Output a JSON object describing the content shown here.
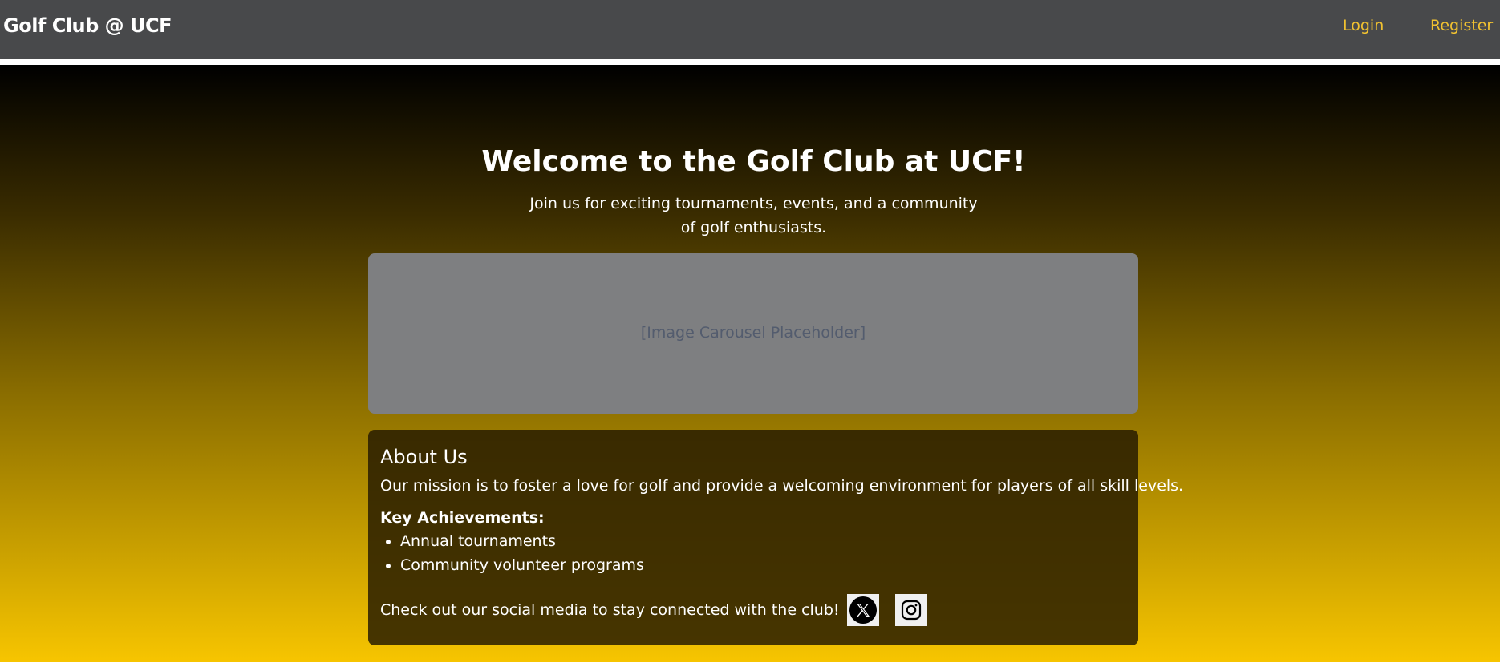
{
  "nav": {
    "brand": "Golf Club @ UCF",
    "login": "Login",
    "register": "Register"
  },
  "hero": {
    "title": "Welcome to the Golf Club at UCF!",
    "subtitle": "Join us for exciting tournaments, events, and a community of golf enthusiasts."
  },
  "carousel": {
    "placeholder": "[Image Carousel Placeholder]"
  },
  "about": {
    "title": "About Us",
    "mission": "Our mission is to foster a love for golf and provide a welcoming environment for players of all skill levels.",
    "achievements_heading": "Key Achievements:",
    "achievements": [
      "Annual tournaments",
      "Community volunteer programs"
    ],
    "social_text": "Check out our social media to stay connected with the club!"
  },
  "social": {
    "icons": [
      "x-icon",
      "instagram-icon"
    ]
  },
  "colors": {
    "navbar": "#48494b",
    "accent": "#f2c230",
    "gradient_top": "#000000",
    "gradient_bottom": "#f7c500",
    "carousel": "#7e7f81",
    "card": "#2d2005"
  }
}
